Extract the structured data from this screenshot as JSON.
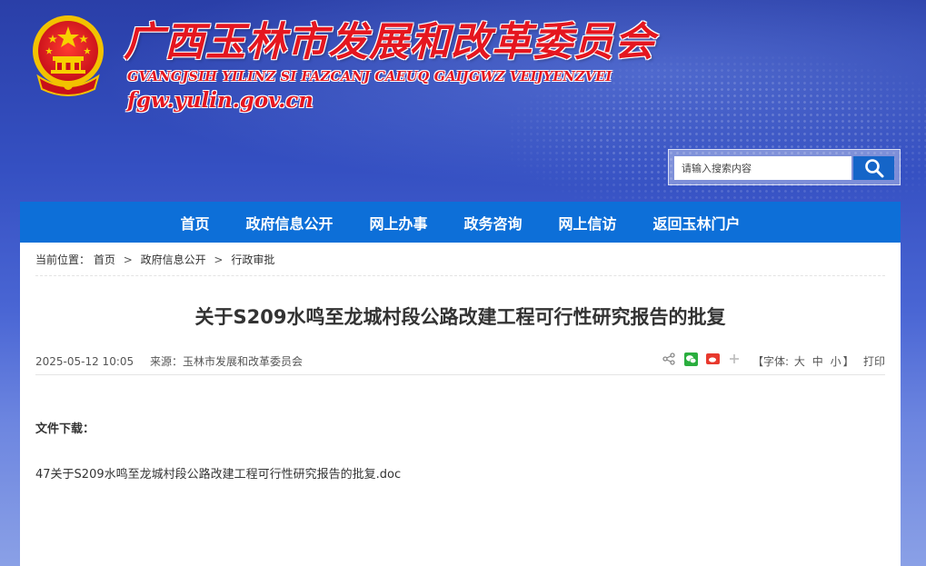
{
  "header": {
    "title": "广西玉林市发展和改革委员会",
    "subtitle": "GVANGJSIH YILINZ SI FAZCANJ CAEUQ GAIJGWZ VEIJYENZVEI",
    "domain": "fgw.yulin.gov.cn",
    "emblem_icon": "national-emblem"
  },
  "search": {
    "placeholder": "请输入搜索内容",
    "value": "",
    "button_icon": "search-icon"
  },
  "nav": {
    "items": [
      {
        "label": "首页"
      },
      {
        "label": "政府信息公开"
      },
      {
        "label": "网上办事"
      },
      {
        "label": "政务咨询"
      },
      {
        "label": "网上信访"
      },
      {
        "label": "返回玉林门户"
      }
    ]
  },
  "breadcrumb": {
    "prefix": "当前位置：",
    "items": [
      "首页",
      "政府信息公开",
      "行政审批"
    ],
    "separator": ">"
  },
  "article": {
    "title": "关于S209水鸣至龙城村段公路改建工程可行性研究报告的批复",
    "date": "2025-05-12 10:05",
    "source_label": "来源：",
    "source": "玉林市发展和改革委员会",
    "font_prefix": "【字体:",
    "font_large": "大",
    "font_medium": "中",
    "font_small": "小",
    "font_suffix": "】",
    "print": "打印",
    "share_icons": [
      "share-icon",
      "wechat-icon",
      "weibo-icon",
      "plus-icon"
    ],
    "downloads_label": "文件下载：",
    "file_name": "47关于S209水鸣至龙城村段公路改建工程可行性研究报告的批复.doc"
  },
  "colors": {
    "brand_red": "#e5161f",
    "nav_blue": "#0d6fd8",
    "search_blue": "#1565c8"
  }
}
